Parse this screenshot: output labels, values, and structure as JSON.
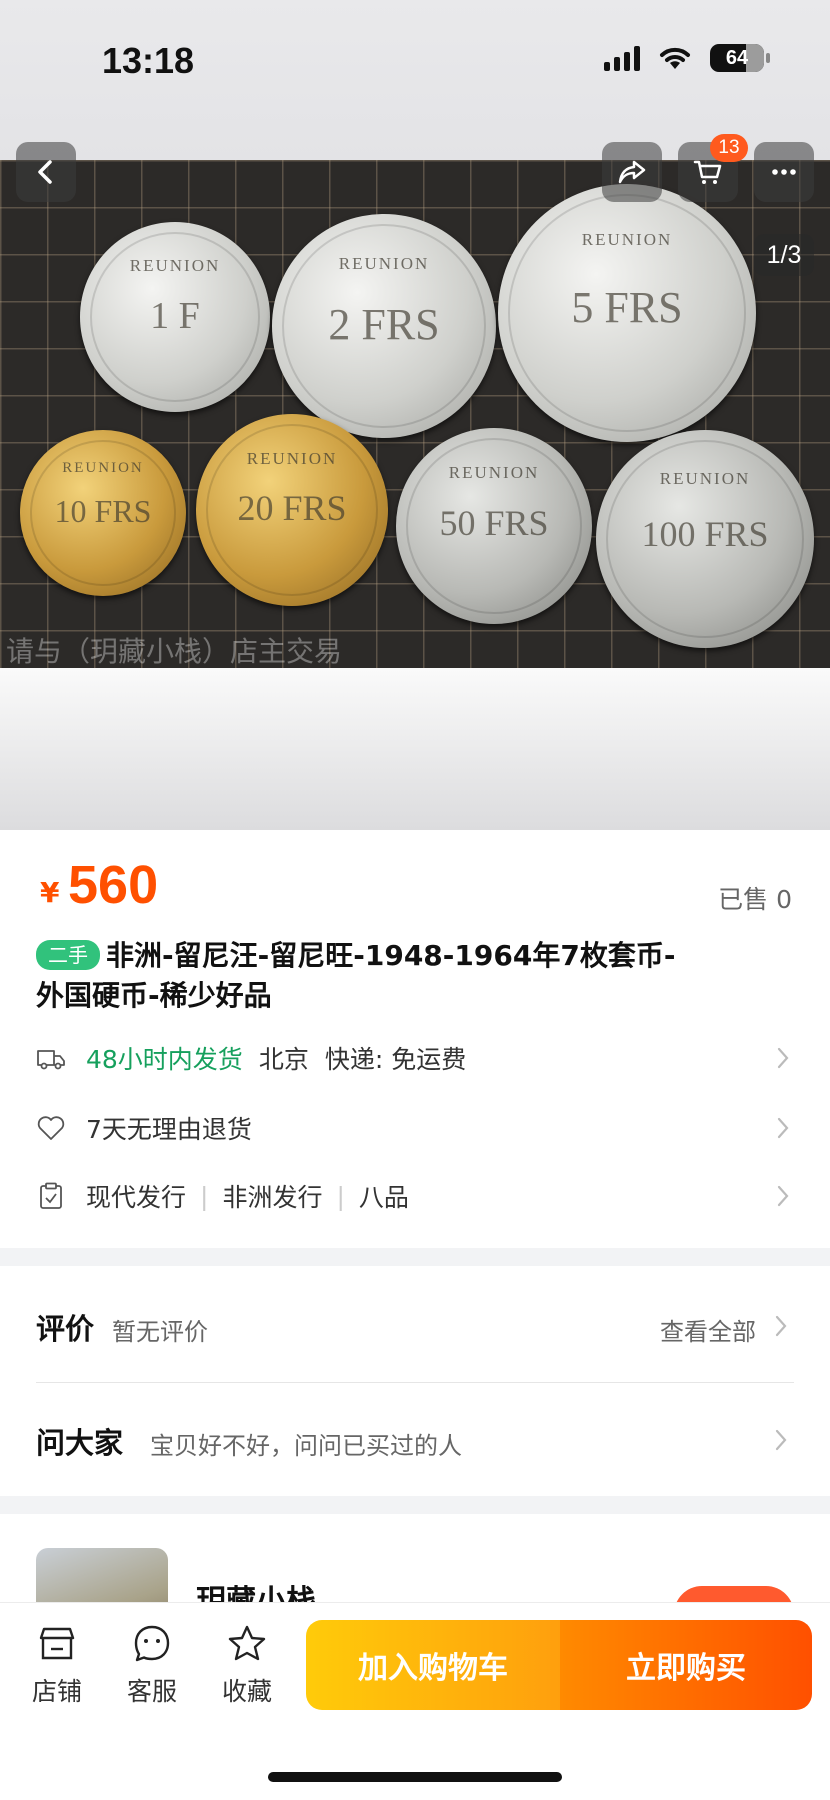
{
  "status_bar": {
    "time": "13:18",
    "battery": "64"
  },
  "gallery": {
    "page_indicator": "1/3",
    "watermark": "请与（玥藏小栈）店主交易",
    "cart_count": "13",
    "coins": [
      {
        "label": "REUNION",
        "value": "1 F"
      },
      {
        "label": "REUNION",
        "value": "2 FRS"
      },
      {
        "label": "REUNION",
        "value": "5 FRS"
      },
      {
        "label": "REUNION",
        "value": "10 FRS"
      },
      {
        "label": "REUNION",
        "value": "20 FRS"
      },
      {
        "label": "REUNION",
        "value": "50 FRS"
      },
      {
        "label": "REUNION",
        "value": "100 FRS"
      }
    ]
  },
  "product": {
    "currency": "¥",
    "price": "560",
    "sold": "已售 0",
    "tag": "二手",
    "title_line1": "非洲-留尼汪-留尼旺-1948-1964年7枚套币-",
    "title_line2": "外国硬币-稀少好品",
    "shipping_time": "48小时内发货",
    "shipping_from": "北京",
    "shipping_fee": "快递: 免运费",
    "return_policy": "7天无理由退货",
    "attrs": [
      "现代发行",
      "非洲发行",
      "八品"
    ]
  },
  "reviews": {
    "title": "评价",
    "status": "暂无评价",
    "view_all": "查看全部",
    "ask_title": "问大家",
    "ask_sub": "宝贝好不好，问问已买过的人"
  },
  "shop": {
    "name": "玥藏小栈"
  },
  "bottom_bar": {
    "shop": "店铺",
    "service": "客服",
    "favorite": "收藏",
    "add_to_cart": "加入购物车",
    "buy_now": "立即购买"
  },
  "colors": {
    "price": "#ff5000",
    "green": "#16a05d",
    "cart_btn": "#ffb30a",
    "buy_btn": "#ff5a00"
  }
}
